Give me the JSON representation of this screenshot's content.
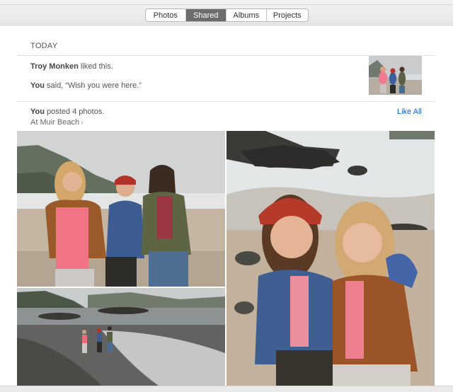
{
  "tabs": [
    {
      "label": "Photos",
      "active": false
    },
    {
      "label": "Shared",
      "active": true
    },
    {
      "label": "Albums",
      "active": false
    },
    {
      "label": "Projects",
      "active": false
    }
  ],
  "activity": {
    "section_title": "TODAY",
    "liker_name": "Troy Monken",
    "liked_text": " liked this.",
    "commenter_name": "You",
    "comment_text": " said, “Wish you were here.”"
  },
  "post": {
    "poster_name": "You",
    "posted_text": " posted 4 photos.",
    "location": "At Muir Beach",
    "like_all_label": "Like All"
  },
  "colors": {
    "accent": "#1a5fd8",
    "active_tab": "#6c6c6c"
  }
}
